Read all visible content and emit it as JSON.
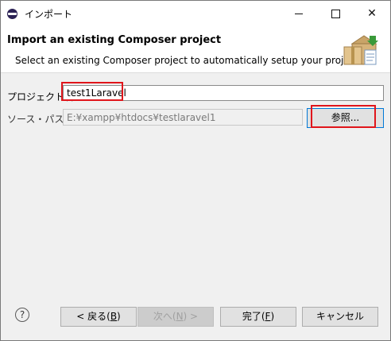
{
  "window": {
    "title": "インポート",
    "minimize": "minimize",
    "maximize": "maximize",
    "close": "✕"
  },
  "header": {
    "title": "Import an existing Composer project",
    "description": "Select an existing Composer project to automatically setup your project."
  },
  "form": {
    "project_name_label": "プロジェクト名:",
    "project_name_value": "test1Laravel",
    "source_path_label": "ソース・パス:",
    "source_path_value": "E:¥xampp¥htdocs¥testlaravel1",
    "browse_label": "参照..."
  },
  "footer": {
    "help": "?",
    "back_text": "< 戻る(",
    "back_key": "B",
    "back_end": ")",
    "next_text": "次へ(",
    "next_key": "N",
    "next_end": ") >",
    "finish_text": "完了(",
    "finish_key": "F",
    "finish_end": ")",
    "cancel_label": "キャンセル"
  },
  "colors": {
    "highlight": "#e0151b",
    "focus_border": "#0078d7",
    "app_icon": "#2c2255"
  }
}
